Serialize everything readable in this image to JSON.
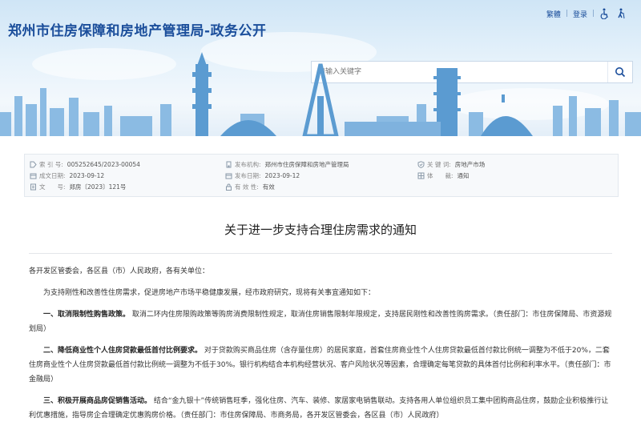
{
  "header": {
    "title": "郑州市住房保障和房地产管理局-政务公开",
    "links": [
      "繁體",
      "登录"
    ],
    "search_placeholder": "请输入关键字"
  },
  "meta": {
    "index_label": "索 引 号:",
    "index_value": "005252645/2023-00054",
    "date_label": "成文日期:",
    "date_value": "2023-09-12",
    "doc_label": "文　　号:",
    "doc_value": "郑房〔2023〕121号",
    "issuer_label": "发布机构:",
    "issuer_value": "郑州市住房保障和房地产管理局",
    "publish_label": "发布日期:",
    "publish_value": "2023-09-12",
    "validity_label": "有 效 性:",
    "validity_value": "有效",
    "keyword_label": "关 键 词:",
    "keyword_value": "房地产市场",
    "genre_label": "体　　裁:",
    "genre_value": "通知"
  },
  "article": {
    "title": "关于进一步支持合理住房需求的通知",
    "salutation": "各开发区管委会，各区县（市）人民政府，各有关单位：",
    "intro": "为支持刚性和改善性住房需求，促进房地产市场平稳健康发展，经市政府研究，现将有关事宜通知如下：",
    "item1_head": "一、取消限制性购售政策。",
    "item1_text": "取消二环内住房限购政策等购房消费限制性规定，取消住房销售限制年限规定，支持居民刚性和改善性购房需求。（责任部门：市住房保障局、市资源规划局）",
    "item2_head": "二、降低商业性个人住房贷款最低首付比例要求。",
    "item2_text": "对于贷款购买商品住房（含存量住房）的居民家庭，首套住房商业性个人住房贷款最低首付款比例统一调整为不低于20%，二套住房商业性个人住房贷款最低首付款比例统一调整为不低于30%。银行机构结合本机构经营状况、客户风险状况等因素，合理确定每笔贷款的具体首付比例和利率水平。（责任部门：市金融局）",
    "item3_head": "三、积极开展商品房促销售活动。",
    "item3_text": "结合“金九银十”传统销售旺季，强化住房、汽车、装修、家居家电销售联动。支持各用人单位组织员工集中团购商品住房，鼓励企业积极推行让利优惠措施，指导房企合理确定优惠购房价格。（责任部门：市住房保障局、市商务局，各开发区管委会，各区县（市）人民政府）"
  },
  "colors": {
    "brand": "#1b4e9b",
    "banner_sky": "#cfe5f6",
    "skyline": "#6fa8d8"
  }
}
